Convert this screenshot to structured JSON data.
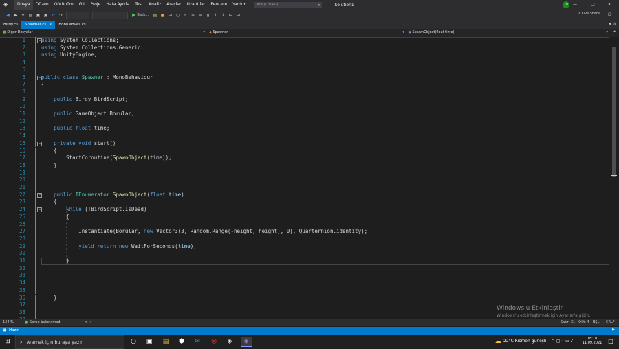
{
  "menu": {
    "items": [
      "Dosya",
      "Düzen",
      "Görünüm",
      "Git",
      "Proje",
      "Hata Ayıkla",
      "Test",
      "Analiz",
      "Araçlar",
      "Uzantılar",
      "Pencere",
      "Yardım"
    ],
    "search_placeholder": "Ara (Ctrl+Q)",
    "solution": "Solution1",
    "avatar": "TO"
  },
  "toolbar": {
    "run_label": "İliştir...",
    "live_share": "Live Share"
  },
  "tabs": [
    {
      "label": "Birdy.cs",
      "active": false
    },
    {
      "label": "Spawner.cs",
      "active": true
    },
    {
      "label": "BonuMoves.cs",
      "active": false
    }
  ],
  "navbar": {
    "project": "Diğer Dosyalar",
    "class": "Spawner",
    "member": "SpawnObject(float time)"
  },
  "code_lines": [
    [
      [
        "kw",
        "using"
      ],
      [
        "df",
        " System.Collections;"
      ]
    ],
    [
      [
        "kw",
        "using"
      ],
      [
        "df",
        " System.Collections.Generic;"
      ]
    ],
    [
      [
        "kw",
        "using"
      ],
      [
        "df",
        " UnityEngine;"
      ]
    ],
    [],
    [],
    [
      [
        "kw",
        "public class "
      ],
      [
        "ty",
        "Spawner"
      ],
      [
        "df",
        " : MonoBehaviour"
      ]
    ],
    [
      [
        "df",
        "{"
      ]
    ],
    [],
    [
      [
        "df",
        "    "
      ],
      [
        "kw",
        "public"
      ],
      [
        "df",
        " Birdy BirdScript;"
      ]
    ],
    [],
    [
      [
        "df",
        "    "
      ],
      [
        "kw",
        "public"
      ],
      [
        "df",
        " GameObject Borular;"
      ]
    ],
    [],
    [
      [
        "df",
        "    "
      ],
      [
        "kw",
        "public float"
      ],
      [
        "df",
        " time;"
      ]
    ],
    [],
    [
      [
        "df",
        "    "
      ],
      [
        "kw",
        "private void"
      ],
      [
        "df",
        " start()"
      ]
    ],
    [
      [
        "df",
        "    {"
      ]
    ],
    [
      [
        "df",
        "        StartCoroutine("
      ],
      [
        "fn",
        "SpawnObject"
      ],
      [
        "df",
        "(time));"
      ]
    ],
    [
      [
        "df",
        "    }"
      ]
    ],
    [],
    [],
    [],
    [
      [
        "df",
        "    "
      ],
      [
        "kw",
        "public"
      ],
      [
        "df",
        " "
      ],
      [
        "ty",
        "IEnumerator"
      ],
      [
        "df",
        " "
      ],
      [
        "fn",
        "SpawnObject"
      ],
      [
        "df",
        "("
      ],
      [
        "kw",
        "float"
      ],
      [
        "df",
        " "
      ],
      [
        "id",
        "time"
      ],
      [
        "df",
        ")"
      ]
    ],
    [
      [
        "df",
        "    {"
      ]
    ],
    [
      [
        "df",
        "        "
      ],
      [
        "kw",
        "while"
      ],
      [
        "df",
        " (!BirdScript.İsDead)"
      ]
    ],
    [
      [
        "df",
        "        {"
      ]
    ],
    [],
    [
      [
        "df",
        "            Instantiate(Borular, "
      ],
      [
        "kw",
        "new"
      ],
      [
        "df",
        " Vector3(3, Random.Range(-height, height), 0), Quarternion.identity);"
      ]
    ],
    [],
    [
      [
        "df",
        "            "
      ],
      [
        "kw",
        "yield return new"
      ],
      [
        "df",
        " WaitForSeconds("
      ],
      [
        "id",
        "time"
      ],
      [
        "df",
        ");"
      ]
    ],
    [],
    [
      [
        "df",
        "        }"
      ]
    ],
    [],
    [],
    [],
    [],
    [
      [
        "df",
        "    }"
      ]
    ],
    [],
    [],
    []
  ],
  "watermark": {
    "title": "Windows'u Etkinleştir",
    "subtitle": "Windows'u etkinleştirmek için Ayarlar'a gidin."
  },
  "editor_status": {
    "zoom": "134 %",
    "issues": "Sorun bulunamadı",
    "line": "Satır: 31",
    "char": "Krkt: 4",
    "mode": "BŞL",
    "eol": "CRLF"
  },
  "status": {
    "ready": "Hazır"
  },
  "taskbar": {
    "search_placeholder": "Aramak için buraya yazın",
    "weather": "22°C  Kısmen güneşli",
    "time": "18:18",
    "date": "11.09.2021"
  }
}
